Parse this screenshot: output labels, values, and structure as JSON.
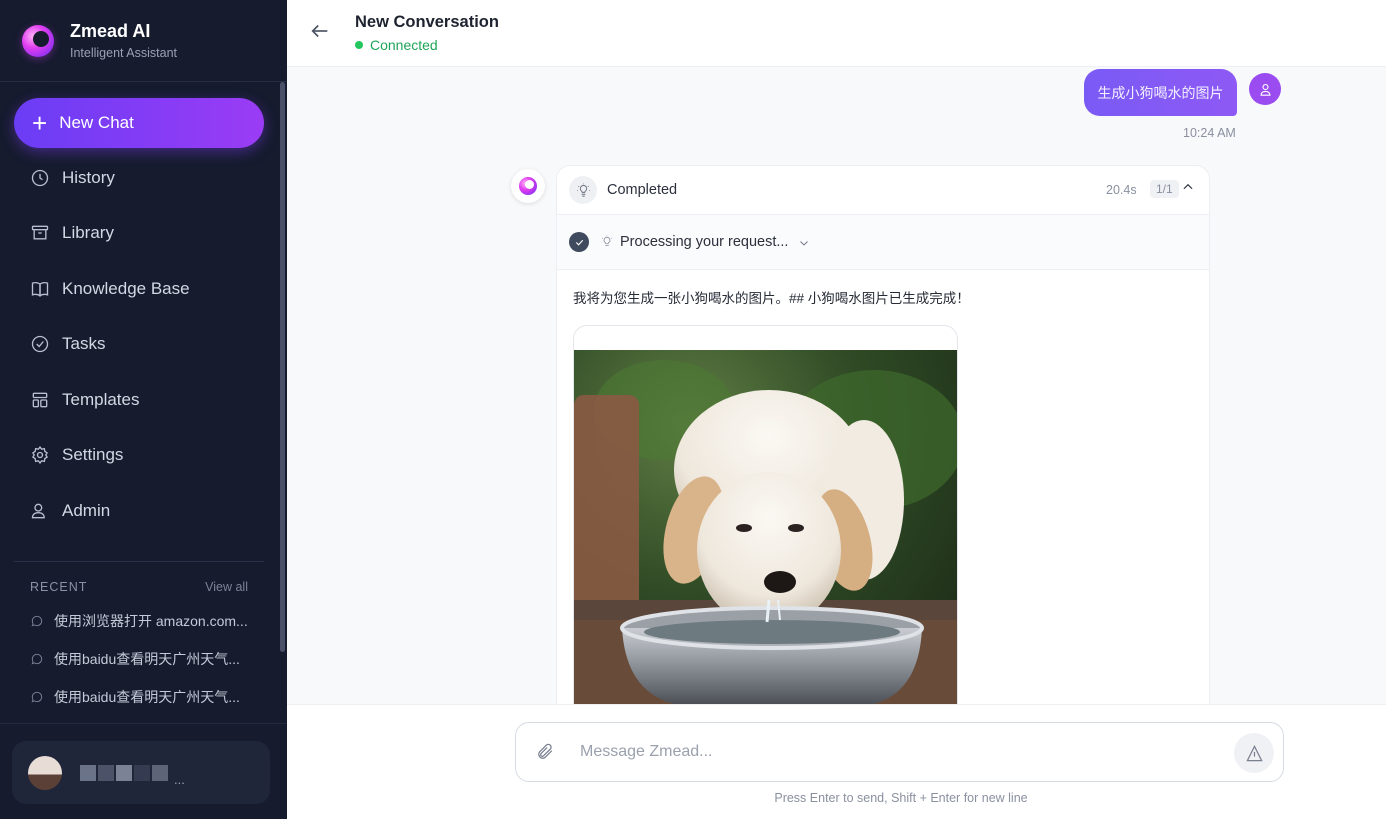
{
  "brand": {
    "title": "Zmead AI",
    "subtitle": "Intelligent Assistant"
  },
  "sidebar": {
    "new_chat_label": "New Chat",
    "items": [
      {
        "label": "History",
        "icon": "clock-icon"
      },
      {
        "label": "Library",
        "icon": "archive-icon"
      },
      {
        "label": "Knowledge Base",
        "icon": "book-icon"
      },
      {
        "label": "Tasks",
        "icon": "check-circle-icon"
      },
      {
        "label": "Templates",
        "icon": "layout-icon"
      },
      {
        "label": "Settings",
        "icon": "gear-icon"
      },
      {
        "label": "Admin",
        "icon": "users-icon"
      }
    ],
    "recent_title": "RECENT",
    "view_all": "View all",
    "recent": [
      "使用浏览器打开 amazon.com...",
      "使用baidu查看明天广州天气...",
      "使用baidu查看明天广州天气..."
    ],
    "user_name": "..."
  },
  "header": {
    "title": "New Conversation",
    "status": "Connected"
  },
  "chat": {
    "user_message": "生成小狗喝水的图片",
    "user_time": "10:24 AM",
    "assistant": {
      "status": "Completed",
      "duration": "20.4s",
      "count": "1/1",
      "step_label": "Processing your request...",
      "answer_text": "我将为您生成一张小狗喝水的图片。## 小狗喝水图片已生成完成！"
    }
  },
  "composer": {
    "placeholder": "Message Zmead...",
    "hint": "Press Enter to send, Shift + Enter for new line"
  },
  "colors": {
    "sidebar_bg": "#161b2e",
    "accent": "#7c4df5",
    "connected": "#22c55e"
  }
}
